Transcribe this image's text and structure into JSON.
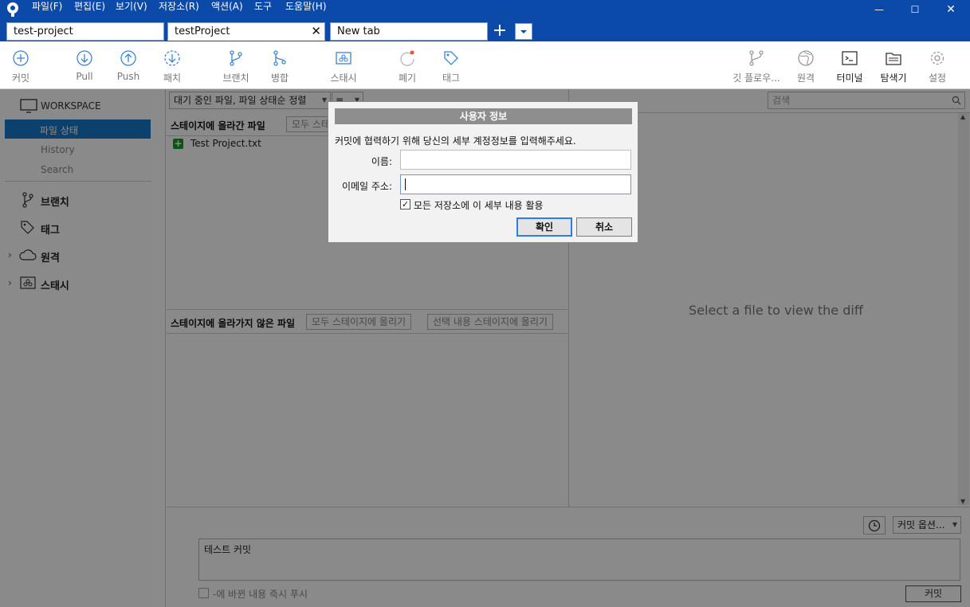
{
  "menu": [
    "파일(F)",
    "편집(E)",
    "보기(V)",
    "저장소(R)",
    "액션(A)",
    "도구",
    "도움말(H)"
  ],
  "window_controls": {
    "minimize": "—",
    "maximize": "☐",
    "close": "✕"
  },
  "tabs": [
    {
      "label": "test-project"
    },
    {
      "label": "testProject",
      "close": "✕"
    },
    {
      "label": "New tab"
    }
  ],
  "tab_add": "+",
  "toolbar": {
    "commit": "커밋",
    "pull": "Pull",
    "push": "Push",
    "fetch": "패치",
    "branch": "브랜치",
    "merge": "병합",
    "stash": "스태시",
    "discard": "폐기",
    "tag": "태그",
    "git_flow": "깃 플로우...",
    "remote": "원격",
    "terminal": "터미널",
    "explorer": "탐색기",
    "settings": "설정"
  },
  "sidebar": {
    "workspace": "WORKSPACE",
    "file_status": "파일 상태",
    "history": "History",
    "search": "Search",
    "branches": "브랜치",
    "tags": "태그",
    "remotes": "원격",
    "stashes": "스태시"
  },
  "filter": {
    "status_sort": "대기 중인 파일, 파일 상태순 정렬",
    "view_icon": "≡"
  },
  "staged": {
    "title": "스테이지에 올라간 파일",
    "unstage_all": "모두 스테이지에서 내리기",
    "files": [
      "Test Project.txt"
    ],
    "add_icon": "+"
  },
  "unstaged": {
    "title": "스테이지에 올라가지 않은 파일",
    "stage_all": "모두 스테이지에 올리기",
    "stage_selected": "선택 내용 스테이지에 올리기"
  },
  "search": {
    "placeholder": "검색"
  },
  "diff": {
    "placeholder": "Select a file to view the diff"
  },
  "commit": {
    "options": "커밋 옵션...",
    "message": "테스트 커밋",
    "push_immediately": "-에 바뀐 내용 즉시 푸시",
    "button": "커밋"
  },
  "dialog": {
    "title": "사용자 정보",
    "message": "커밋에 협력하기 위해 당신의 세부 계정정보를 입력해주세요.",
    "name_label": "이름:",
    "name_value": "",
    "email_label": "이메일 주소:",
    "email_value": "",
    "global_checkbox_label": "모든 저장소에 이 세부 내용 활용",
    "global_checked": true,
    "ok": "확인",
    "cancel": "취소"
  },
  "colors": {
    "titlebar": "#0b4aa8",
    "selection": "#1979ca",
    "toolbar_icon": "#3b86d4"
  }
}
